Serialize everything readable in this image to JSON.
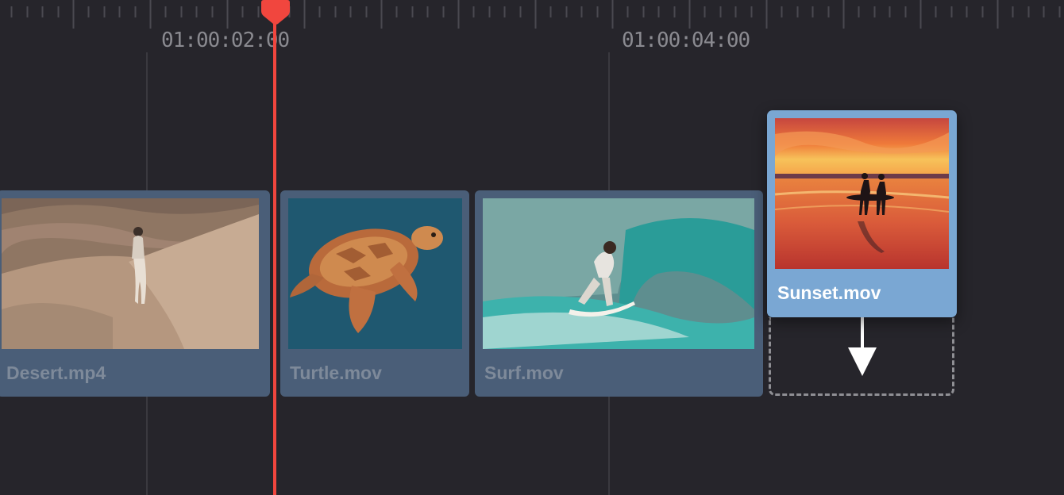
{
  "timeline": {
    "timecodes": [
      "01:00:02:00",
      "01:00:04:00"
    ]
  },
  "clips": [
    {
      "name": "Desert.mp4",
      "thumb_icon": "desert-figure-icon"
    },
    {
      "name": "Turtle.mov",
      "thumb_icon": "sea-turtle-icon"
    },
    {
      "name": "Surf.mov",
      "thumb_icon": "surfer-wave-icon"
    }
  ],
  "dragged_clip": {
    "name": "Sunset.mov",
    "thumb_icon": "sunset-surfers-icon"
  },
  "colors": {
    "background": "#26252b",
    "clip": "#4a5e78",
    "dragged_clip": "#7aa7d3",
    "playhead": "#f1463e"
  }
}
